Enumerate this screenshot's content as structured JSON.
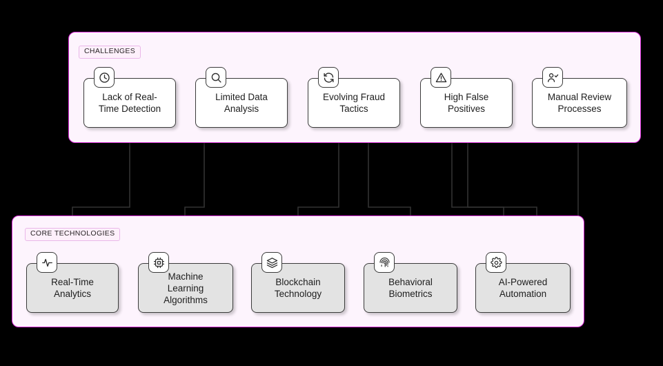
{
  "background_color": "#000000",
  "diagram": {
    "type": "flowchart",
    "direction": "top-to-bottom",
    "subgraphs": [
      {
        "id": "challenges",
        "label": "CHALLENGES",
        "fill": "#fdf4fd",
        "border": "#d92ad9",
        "node_fill": "#ffffff",
        "nodes": [
          {
            "id": "c1",
            "label": "Lack of Real-\nTime Detection",
            "icon": "clock-icon"
          },
          {
            "id": "c2",
            "label": "Limited Data\nAnalysis",
            "icon": "search-icon"
          },
          {
            "id": "c3",
            "label": "Evolving Fraud\nTactics",
            "icon": "refresh-cycle-icon"
          },
          {
            "id": "c4",
            "label": "High False\nPositives",
            "icon": "warning-triangle-icon"
          },
          {
            "id": "c5",
            "label": "Manual Review\nProcesses",
            "icon": "user-check-icon"
          }
        ]
      },
      {
        "id": "core_technologies",
        "label": "CORE TECHNOLOGIES",
        "fill": "#fdf4fd",
        "border": "#d92ad9",
        "node_fill": "#e3e3e3",
        "nodes": [
          {
            "id": "t1",
            "label": "Real-Time\nAnalytics",
            "icon": "activity-pulse-icon"
          },
          {
            "id": "t2",
            "label": "Machine\nLearning\nAlgorithms",
            "icon": "cpu-chip-icon"
          },
          {
            "id": "t3",
            "label": "Blockchain\nTechnology",
            "icon": "layers-stack-icon"
          },
          {
            "id": "t4",
            "label": "Behavioral\nBiometrics",
            "icon": "fingerprint-icon"
          },
          {
            "id": "t5",
            "label": "AI-Powered\nAutomation",
            "icon": "gear-icon"
          }
        ]
      }
    ],
    "edges": [
      {
        "from": "c1",
        "to": "t1"
      },
      {
        "from": "c2",
        "to": "t2"
      },
      {
        "from": "c3",
        "to": "t3"
      },
      {
        "from": "c3",
        "to": "t4"
      },
      {
        "from": "c4",
        "to": "t4"
      },
      {
        "from": "c4",
        "to": "t5"
      },
      {
        "from": "c5",
        "to": "t5"
      }
    ]
  }
}
